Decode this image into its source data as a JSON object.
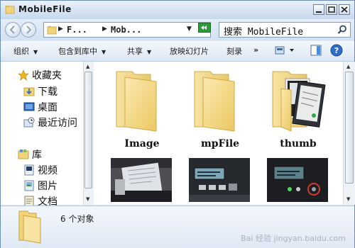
{
  "window": {
    "title": "MobileFile"
  },
  "address": {
    "parts": [
      "F...",
      "Mob..."
    ]
  },
  "search": {
    "text": "搜索 MobileFile"
  },
  "toolbar": {
    "organize": "组织",
    "include_library": "包含到库中",
    "share": "共享",
    "slideshow": "放映幻灯片",
    "burn": "刻录",
    "more": "»"
  },
  "nav": {
    "favorites": "收藏夹",
    "downloads": "下载",
    "desktop": "桌面",
    "recent": "最近访问",
    "libraries": "库",
    "videos": "视频",
    "pictures": "图片",
    "documents": "文档"
  },
  "items": [
    {
      "label": "Image",
      "type": "folder"
    },
    {
      "label": "mpFile",
      "type": "folder"
    },
    {
      "label": "thumb",
      "type": "folder-with-photos"
    }
  ],
  "photos": [
    "photo-1",
    "photo-2",
    "photo-3"
  ],
  "status": {
    "count_text": "6 个对象"
  },
  "watermark": "Bai 经验 jingyan.baidu.com"
}
